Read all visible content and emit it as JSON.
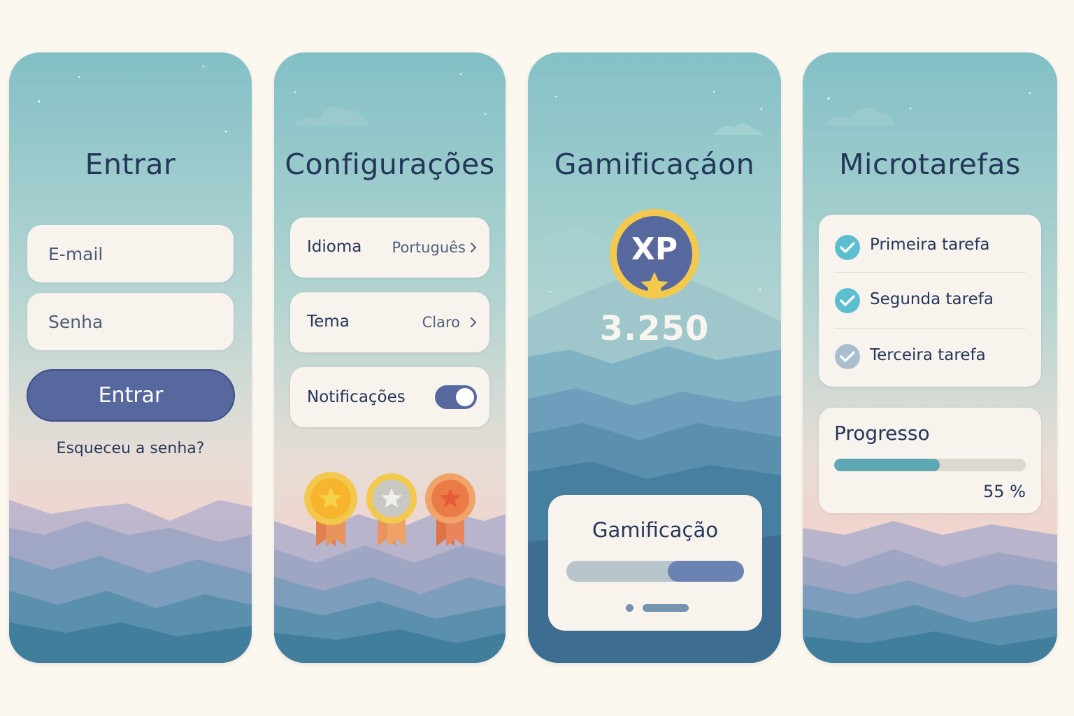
{
  "login": {
    "title": "Entrar",
    "email_placeholder": "E-mail",
    "password_placeholder": "Senha",
    "submit_label": "Entrar",
    "forgot_label": "Esqueceu a senha?"
  },
  "settings": {
    "title": "Configurações",
    "rows": [
      {
        "label": "Idioma",
        "value": "Português"
      },
      {
        "label": "Tema",
        "value": "Claro"
      },
      {
        "label": "Notificações",
        "toggle_on": true
      }
    ],
    "medals": [
      "gold-medal-icon",
      "silver-medal-icon",
      "bronze-medal-icon"
    ]
  },
  "gamification": {
    "title": "Gamificaçáon",
    "badge_text": "XP",
    "score": "3.250",
    "card_title": "Gamificação",
    "progress_fraction": 0.43
  },
  "microtasks": {
    "title": "Microtarefas",
    "tasks": [
      {
        "label": "Primeira tarefa",
        "done": true
      },
      {
        "label": "Segunda tarefa",
        "done": true
      },
      {
        "label": "Terceira tarefa",
        "done": false
      }
    ],
    "progress_title": "Progresso",
    "progress_value": 0.55,
    "progress_label": "55 %"
  },
  "colors": {
    "accent": "#56689e",
    "teal": "#5fa7b3",
    "gold": "#f2c94c",
    "card": "#f8f3ec",
    "text": "#24365a"
  }
}
